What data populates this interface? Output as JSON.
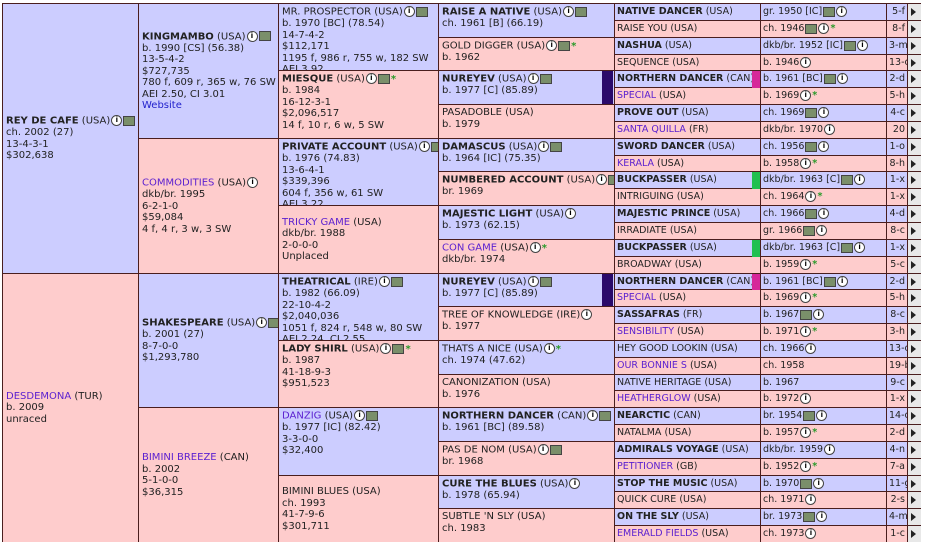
{
  "horses": [
    {
      "id": "g1a",
      "name": "REY DE CAFE",
      "reg": " (USA)",
      "link": false,
      "sex": "m",
      "lines": [
        "ch. 2002 (27)",
        "13-4-3-1",
        "$302,638"
      ],
      "icons": [
        "i",
        "p"
      ],
      "star": false
    },
    {
      "id": "g1b",
      "name": "DESDEMONA",
      "reg": " (TUR)",
      "link": true,
      "sex": "f",
      "lines": [
        "b. 2009",
        "unraced"
      ],
      "icons": [],
      "star": false
    },
    {
      "id": "g2a",
      "name": "KINGMAMBO",
      "reg": " (USA)",
      "link": false,
      "sex": "m",
      "lines": [
        "b. 1990 [CS] (56.38)",
        "13-5-4-2",
        "$727,735",
        "780 f, 609 r, 365 w, 76 SW",
        "AEI 2.50, CI 3.01"
      ],
      "website": "Website",
      "icons": [
        "i",
        "p"
      ],
      "star": false
    },
    {
      "id": "g2b",
      "name": "COMMODITIES",
      "reg": " (USA)",
      "link": true,
      "sex": "f",
      "lines": [
        "dkb/br. 1995",
        "6-2-1-0",
        "$59,084",
        "4 f, 4 r, 3 w, 3 SW"
      ],
      "icons": [
        "i"
      ],
      "star": false
    },
    {
      "id": "g2c",
      "name": "SHAKESPEARE",
      "reg": " (USA)",
      "link": false,
      "sex": "m",
      "lines": [
        "b. 2001 (27)",
        "8-7-0-0",
        "$1,293,780"
      ],
      "icons": [
        "i",
        "p"
      ],
      "star": false
    },
    {
      "id": "g2d",
      "name": "BIMINI BREEZE",
      "reg": " (CAN)",
      "link": true,
      "sex": "f",
      "lines": [
        "b. 2002",
        "5-1-0-0",
        "$36,315"
      ],
      "icons": [],
      "star": false
    },
    {
      "id": "g3a",
      "name": "MR. PROSPECTOR",
      "reg": " (USA)",
      "link": false,
      "plain": true,
      "sex": "m",
      "lines": [
        "b. 1970 [BC] (78.54)",
        "14-7-4-2",
        "$112,171",
        "1195 f, 986 r, 755 w, 182 SW",
        "AEI 3.92"
      ],
      "icons": [
        "i",
        "p"
      ],
      "star": false
    },
    {
      "id": "g3b",
      "name": "MIESQUE",
      "reg": " (USA)",
      "link": false,
      "sex": "f",
      "lines": [
        "b. 1984",
        "16-12-3-1",
        "$2,096,517",
        "14 f, 10 r, 6 w, 5 SW"
      ],
      "icons": [
        "i",
        "p"
      ],
      "star": true
    },
    {
      "id": "g3c",
      "name": "PRIVATE ACCOUNT",
      "reg": " (USA)",
      "link": false,
      "sex": "m",
      "lines": [
        "b. 1976 (74.83)",
        "13-6-4-1",
        "$339,396",
        "604 f, 356 w, 61 SW",
        "AEI 3.22"
      ],
      "website": "Website",
      "icons": [
        "i",
        "p"
      ],
      "star": false
    },
    {
      "id": "g3d",
      "name": "TRICKY GAME",
      "reg": " (USA)",
      "link": true,
      "sex": "f",
      "lines": [
        "dkb/br. 1988",
        "2-0-0-0",
        "Unplaced"
      ],
      "icons": [],
      "star": false
    },
    {
      "id": "g3e",
      "name": "THEATRICAL",
      "reg": " (IRE)",
      "link": false,
      "sex": "m",
      "lines": [
        "b. 1982 (66.09)",
        "22-10-4-2",
        "$2,040,036",
        "1051 f, 824 r, 548 w, 80 SW",
        "AEI 2.24, CI 2.55"
      ],
      "icons": [
        "i",
        "p"
      ],
      "star": false
    },
    {
      "id": "g3f",
      "name": "LADY SHIRL",
      "reg": " (USA)",
      "link": false,
      "sex": "f",
      "lines": [
        "b. 1987",
        "41-18-9-3",
        "$951,523"
      ],
      "icons": [
        "i",
        "p"
      ],
      "star": true
    },
    {
      "id": "g3g",
      "name": "DANZIG",
      "reg": " (USA)",
      "link": true,
      "sex": "m",
      "lines": [
        "b. 1977 [IC] (82.42)",
        "3-3-0-0",
        "$32,400"
      ],
      "icons": [
        "i",
        "p"
      ],
      "star": false
    },
    {
      "id": "g3h",
      "name": "BIMINI BLUES",
      "reg": " (USA)",
      "link": false,
      "plain": true,
      "sex": "f",
      "lines": [
        "ch. 1993",
        "41-7-9-6",
        "$301,711"
      ],
      "icons": [],
      "star": false
    },
    {
      "id": "g4a",
      "name": "RAISE A NATIVE",
      "reg": " (USA)",
      "link": false,
      "sex": "m",
      "lines": [
        "ch. 1961 [B] (66.19)"
      ],
      "icons": [
        "i",
        "p"
      ],
      "star": false
    },
    {
      "id": "g4b",
      "name": "GOLD DIGGER",
      "reg": " (USA)",
      "link": false,
      "plain": true,
      "sex": "f",
      "lines": [
        "b. 1962"
      ],
      "icons": [
        "i",
        "p"
      ],
      "star": true
    },
    {
      "id": "g4c",
      "name": "NUREYEV",
      "reg": " (USA)",
      "link": false,
      "sex": "m",
      "lines": [
        "b. 1977 [C] (85.89)"
      ],
      "icons": [
        "i",
        "p"
      ],
      "star": false
    },
    {
      "id": "g4d",
      "name": "PASADOBLE",
      "reg": " (USA)",
      "link": false,
      "plain": true,
      "sex": "f",
      "lines": [
        "b. 1979"
      ],
      "icons": [],
      "star": false
    },
    {
      "id": "g4e",
      "name": "DAMASCUS",
      "reg": " (USA)",
      "link": false,
      "sex": "m",
      "lines": [
        "b. 1964 [IC] (75.35)"
      ],
      "icons": [
        "i",
        "p"
      ],
      "star": false
    },
    {
      "id": "g4f",
      "name": "NUMBERED ACCOUNT",
      "reg": " (USA)",
      "link": false,
      "sex": "f",
      "lines": [
        "br. 1969"
      ],
      "icons": [
        "i",
        "p"
      ],
      "star": true
    },
    {
      "id": "g4g",
      "name": "MAJESTIC LIGHT",
      "reg": " (USA)",
      "link": false,
      "sex": "m",
      "lines": [
        "b. 1973 (62.15)"
      ],
      "icons": [
        "i"
      ],
      "star": false
    },
    {
      "id": "g4h",
      "name": "CON GAME",
      "reg": " (USA)",
      "link": true,
      "sex": "f",
      "lines": [
        "dkb/br. 1974"
      ],
      "icons": [
        "i"
      ],
      "star": true
    },
    {
      "id": "g4i",
      "name": "NUREYEV",
      "reg": " (USA)",
      "link": false,
      "sex": "m",
      "lines": [
        "b. 1977 [C] (85.89)"
      ],
      "icons": [
        "i",
        "p"
      ],
      "star": false
    },
    {
      "id": "g4j",
      "name": "TREE OF KNOWLEDGE",
      "reg": " (IRE)",
      "link": false,
      "plain": true,
      "sex": "f",
      "lines": [
        "b. 1977"
      ],
      "icons": [
        "i"
      ],
      "star": false
    },
    {
      "id": "g4k",
      "name": "THATS A NICE",
      "reg": " (USA)",
      "link": false,
      "plain": true,
      "sex": "m",
      "lines": [
        "ch. 1974 (47.62)"
      ],
      "icons": [
        "i"
      ],
      "star": true
    },
    {
      "id": "g4l",
      "name": "CANONIZATION",
      "reg": " (USA)",
      "link": false,
      "plain": true,
      "sex": "f",
      "lines": [
        "b. 1976"
      ],
      "icons": [],
      "star": false
    },
    {
      "id": "g4m",
      "name": "NORTHERN DANCER",
      "reg": " (CAN)",
      "link": false,
      "sex": "m",
      "lines": [
        "b. 1961 [BC] (89.58)"
      ],
      "icons": [
        "i",
        "p"
      ],
      "star": false
    },
    {
      "id": "g4n",
      "name": "PAS DE NOM",
      "reg": " (USA)",
      "link": false,
      "plain": true,
      "sex": "f",
      "lines": [
        "br. 1968"
      ],
      "icons": [
        "i",
        "p"
      ],
      "star": false
    },
    {
      "id": "g4o",
      "name": "CURE THE BLUES",
      "reg": " (USA)",
      "link": false,
      "sex": "m",
      "lines": [
        "b. 1978 (65.94)"
      ],
      "icons": [
        "i"
      ],
      "star": false
    },
    {
      "id": "g4p",
      "name": "SUBTLE 'N SLY",
      "reg": " (USA)",
      "link": false,
      "plain": true,
      "sex": "f",
      "lines": [
        "ch. 1983"
      ],
      "icons": [],
      "star": false
    }
  ],
  "gen5": [
    {
      "name": "NATIVE DANCER",
      "reg": " (USA)",
      "bold": true,
      "link": false,
      "sex": "m",
      "det": "gr. 1950 [IC]",
      "icons": [
        "p",
        "i"
      ],
      "star": false,
      "num": "5-f"
    },
    {
      "name": "RAISE YOU",
      "reg": " (USA)",
      "bold": false,
      "link": false,
      "sex": "f",
      "det": "ch. 1946",
      "icons": [
        "p",
        "i"
      ],
      "star": true,
      "num": "8-f"
    },
    {
      "name": "NASHUA",
      "reg": " (USA)",
      "bold": true,
      "link": false,
      "sex": "m",
      "det": "dkb/br. 1952 [IC]",
      "icons": [
        "p",
        "i"
      ],
      "star": false,
      "num": "3-m"
    },
    {
      "name": "SEQUENCE",
      "reg": " (USA)",
      "bold": false,
      "link": false,
      "sex": "f",
      "det": "b. 1946",
      "icons": [
        "i"
      ],
      "star": false,
      "num": "13-c"
    },
    {
      "name": "NORTHERN DANCER",
      "reg": " (CAN)",
      "bold": true,
      "link": false,
      "sex": "m",
      "det": "b. 1961 [BC]",
      "icons": [
        "p",
        "i"
      ],
      "star": false,
      "num": "2-d",
      "bar": "#d6279a",
      "span": 2
    },
    {
      "name": "SPECIAL",
      "reg": " (USA)",
      "bold": false,
      "link": true,
      "sex": "f",
      "det": "b. 1969",
      "icons": [
        "i"
      ],
      "star": true,
      "num": "5-h"
    },
    {
      "name": "PROVE OUT",
      "reg": " (USA)",
      "bold": true,
      "link": false,
      "sex": "m",
      "det": "ch. 1969",
      "icons": [
        "p",
        "i"
      ],
      "star": false,
      "num": "4-c"
    },
    {
      "name": "SANTA QUILLA",
      "reg": " (FR)",
      "bold": false,
      "link": true,
      "sex": "f",
      "det": "dkb/br. 1970",
      "icons": [
        "i"
      ],
      "star": false,
      "num": "20"
    },
    {
      "name": "SWORD DANCER",
      "reg": " (USA)",
      "bold": true,
      "link": false,
      "sex": "m",
      "det": "ch. 1956",
      "icons": [
        "p",
        "i"
      ],
      "star": false,
      "num": "1-o"
    },
    {
      "name": "KERALA",
      "reg": " (USA)",
      "bold": false,
      "link": true,
      "sex": "f",
      "det": "b. 1958",
      "icons": [
        "i"
      ],
      "star": true,
      "num": "8-h"
    },
    {
      "name": "BUCKPASSER",
      "reg": " (USA)",
      "bold": true,
      "link": false,
      "sex": "m",
      "det": "dkb/br. 1963 [C]",
      "icons": [
        "p",
        "i"
      ],
      "star": false,
      "num": "1-x",
      "bar": "#20c050",
      "span": 2
    },
    {
      "name": "INTRIGUING",
      "reg": " (USA)",
      "bold": false,
      "link": false,
      "sex": "f",
      "det": "ch. 1964",
      "icons": [
        "i"
      ],
      "star": true,
      "num": "1-x"
    },
    {
      "name": "MAJESTIC PRINCE",
      "reg": " (USA)",
      "bold": true,
      "link": false,
      "sex": "m",
      "det": "ch. 1966",
      "icons": [
        "p",
        "i"
      ],
      "star": false,
      "num": "4-d"
    },
    {
      "name": "IRRADIATE",
      "reg": " (USA)",
      "bold": false,
      "link": false,
      "sex": "f",
      "det": "gr. 1966",
      "icons": [
        "p",
        "i"
      ],
      "star": false,
      "num": "8-c"
    },
    {
      "name": "BUCKPASSER",
      "reg": " (USA)",
      "bold": true,
      "link": false,
      "sex": "m",
      "det": "dkb/br. 1963 [C]",
      "icons": [
        "p",
        "i"
      ],
      "star": false,
      "num": "1-x",
      "bar": "#20c050",
      "span": 2
    },
    {
      "name": "BROADWAY",
      "reg": " (USA)",
      "bold": false,
      "link": false,
      "sex": "f",
      "det": "b. 1959",
      "icons": [
        "i"
      ],
      "star": true,
      "num": "5-c"
    },
    {
      "name": "NORTHERN DANCER",
      "reg": " (CAN)",
      "bold": true,
      "link": false,
      "sex": "m",
      "det": "b. 1961 [BC]",
      "icons": [
        "p",
        "i"
      ],
      "star": false,
      "num": "2-d",
      "bar": "#d6279a",
      "span": 2
    },
    {
      "name": "SPECIAL",
      "reg": " (USA)",
      "bold": false,
      "link": true,
      "sex": "f",
      "det": "b. 1969",
      "icons": [
        "i"
      ],
      "star": true,
      "num": "5-h"
    },
    {
      "name": "SASSAFRAS",
      "reg": " (FR)",
      "bold": true,
      "link": false,
      "sex": "m",
      "det": "b. 1967",
      "icons": [
        "p",
        "i"
      ],
      "star": false,
      "num": "8-c"
    },
    {
      "name": "SENSIBILITY",
      "reg": " (USA)",
      "bold": false,
      "link": true,
      "sex": "f",
      "det": "b. 1971",
      "icons": [
        "i"
      ],
      "star": true,
      "num": "3-h"
    },
    {
      "name": "HEY GOOD LOOKIN",
      "reg": " (USA)",
      "bold": false,
      "link": false,
      "sex": "m",
      "det": "ch. 1966",
      "icons": [
        "i"
      ],
      "star": false,
      "num": "13-c"
    },
    {
      "name": "OUR BONNIE S",
      "reg": " (USA)",
      "bold": false,
      "link": true,
      "sex": "f",
      "det": "ch. 1958",
      "icons": [],
      "star": false,
      "num": "19-b"
    },
    {
      "name": "NATIVE HERITAGE",
      "reg": " (USA)",
      "bold": false,
      "link": false,
      "sex": "m",
      "det": "b. 1967",
      "icons": [],
      "star": false,
      "num": "9-c"
    },
    {
      "name": "HEATHERGLOW",
      "reg": " (USA)",
      "bold": false,
      "link": true,
      "sex": "f",
      "det": "b. 1972",
      "icons": [
        "i"
      ],
      "star": false,
      "num": "1-x"
    },
    {
      "name": "NEARCTIC",
      "reg": " (CAN)",
      "bold": true,
      "link": false,
      "sex": "m",
      "det": "br. 1954",
      "icons": [
        "p",
        "i"
      ],
      "star": false,
      "num": "14-c"
    },
    {
      "name": "NATALMA",
      "reg": " (USA)",
      "bold": false,
      "link": false,
      "sex": "f",
      "det": "b. 1957",
      "icons": [
        "i"
      ],
      "star": true,
      "num": "2-d"
    },
    {
      "name": "ADMIRALS VOYAGE",
      "reg": " (USA)",
      "bold": true,
      "link": false,
      "sex": "m",
      "det": "dkb/br. 1959",
      "icons": [
        "i"
      ],
      "star": false,
      "num": "4-n"
    },
    {
      "name": "PETITIONER",
      "reg": " (GB)",
      "bold": false,
      "link": true,
      "sex": "f",
      "det": "b. 1952",
      "icons": [
        "i"
      ],
      "star": true,
      "num": "7-a"
    },
    {
      "name": "STOP THE MUSIC",
      "reg": " (USA)",
      "bold": true,
      "link": false,
      "sex": "m",
      "det": "b. 1970",
      "icons": [
        "p",
        "i"
      ],
      "star": false,
      "num": "11-g"
    },
    {
      "name": "QUICK CURE",
      "reg": " (USA)",
      "bold": false,
      "link": false,
      "sex": "f",
      "det": "ch. 1971",
      "icons": [
        "i"
      ],
      "star": false,
      "num": "2-s"
    },
    {
      "name": "ON THE SLY",
      "reg": " (USA)",
      "bold": true,
      "link": false,
      "sex": "m",
      "det": "br. 1973",
      "icons": [
        "p",
        "i"
      ],
      "star": false,
      "num": "4-m"
    },
    {
      "name": "EMERALD FIELDS",
      "reg": " (USA)",
      "bold": false,
      "link": true,
      "sex": "f",
      "det": "ch. 1973",
      "icons": [
        "i"
      ],
      "star": false,
      "num": "1-c"
    }
  ],
  "colors": {
    "male": "#cccdff",
    "female": "#fecccc",
    "border": "#4a1e1e",
    "link": "#5a1fd0",
    "star": "#2a9a2a",
    "nureyev_bar": "#2a0a6a"
  },
  "icons": {
    "i": "info-icon",
    "p": "photo-icon",
    "star": "star-icon",
    "arrow": "expand-arrow-icon"
  }
}
